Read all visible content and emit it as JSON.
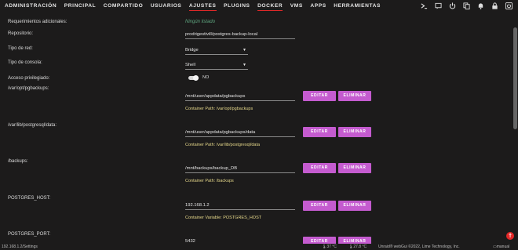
{
  "nav": {
    "items": [
      "ADMINISTRACIÓN",
      "PRINCIPAL",
      "COMPARTIDO",
      "USUARIOS",
      "AJUSTES",
      "PLUGINS",
      "DOCKER",
      "VMS",
      "APPS",
      "HERRAMIENTAS"
    ],
    "active": [
      "AJUSTES",
      "DOCKER"
    ]
  },
  "top_icons": [
    "terminal-icon",
    "feedback-icon",
    "power-icon",
    "copy-icon",
    "notifications-icon",
    "lock-icon",
    "power-off-icon"
  ],
  "form": {
    "requirements": {
      "label": "Requerimientos adicionales:",
      "value": "Ningún listado"
    },
    "repository": {
      "label": "Repositorio:",
      "value": "prodrigestivill/postgres-backup-local"
    },
    "network": {
      "label": "Tipo de red:",
      "value": "Bridge"
    },
    "console": {
      "label": "Tipo de consola:",
      "value": "Shell"
    },
    "privileged": {
      "label": "Acceso privilegiado:",
      "value": "NO"
    },
    "paths": [
      {
        "label": "/var/opt/pgbackups:",
        "value": "/mnt/user/appdata/pgbackups",
        "note": "Container Path: /var/opt/pgbackups"
      },
      {
        "label": "/var/lib/postgresql/data:",
        "value": "/mnt/user/appdata/pgbackups/data",
        "note": "Container Path: /var/lib/postgresql/data"
      },
      {
        "label": "/backups:",
        "value": "/mnt/backups/backup_DB",
        "note": "Container Path: /backups"
      },
      {
        "label": "POSTGRES_HOST:",
        "value": "192.168.1.2",
        "note": "Container Variable: POSTGRES_HOST"
      },
      {
        "label": "POSTGRES_PORT:",
        "value": "5432",
        "note": ""
      }
    ],
    "edit_label": "EDITAR",
    "delete_label": "ELIMINAR"
  },
  "footer": {
    "left": "192.168.1.2/Settings",
    "temp1": "37 °C",
    "temp2": "27.8 °C",
    "copyright": "Unraid® webGui ©2022, Lime Technology, Inc.",
    "manual": "manual"
  },
  "colors": {
    "accent": "#e22828",
    "button": "#c45bcf",
    "link": "#5ea57f",
    "note": "#e6d88a"
  }
}
